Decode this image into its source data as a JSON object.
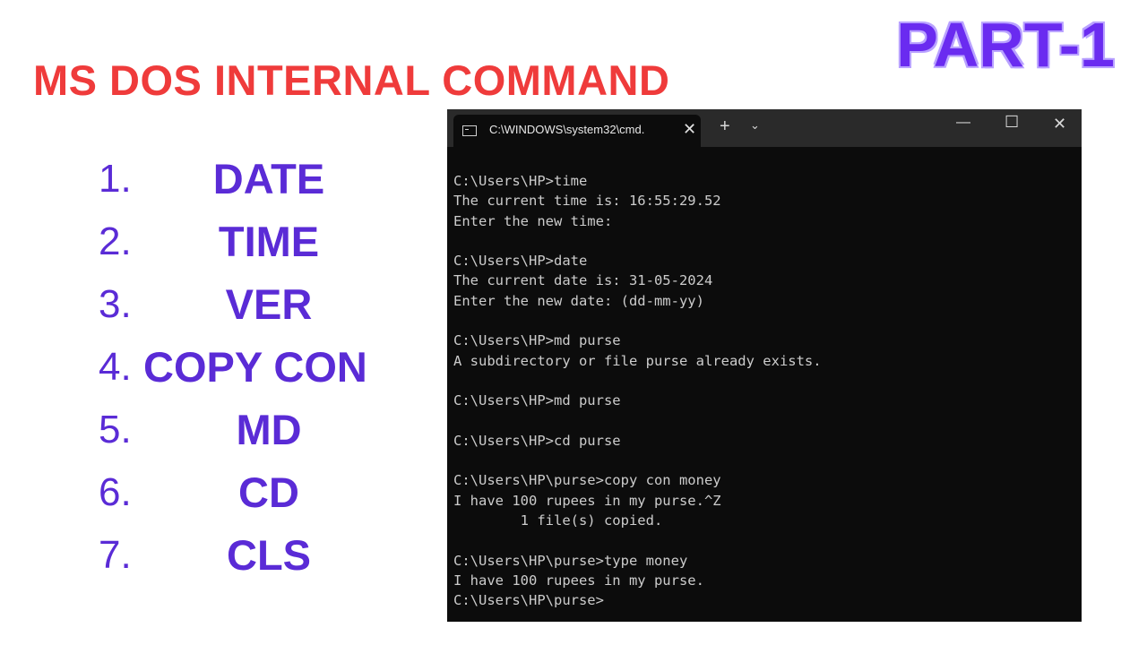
{
  "title": "MS DOS INTERNAL COMMAND",
  "part": "PART-1",
  "commands": [
    {
      "num": "1.",
      "name": "DATE"
    },
    {
      "num": "2.",
      "name": "TIME"
    },
    {
      "num": "3.",
      "name": "VER"
    },
    {
      "num": "4.",
      "name": "COPY CON"
    },
    {
      "num": "5.",
      "name": "MD"
    },
    {
      "num": "6.",
      "name": "CD"
    },
    {
      "num": "7.",
      "name": "CLS"
    }
  ],
  "terminal": {
    "tab_title": "C:\\WINDOWS\\system32\\cmd.",
    "icons": {
      "tab": "cmd-icon",
      "close": "close-icon",
      "new_tab": "plus-icon",
      "dropdown": "chevron-down-icon"
    },
    "window_buttons": {
      "minimize": "—",
      "maximize": "☐",
      "close": "✕"
    },
    "lines": [
      "C:\\Users\\HP>time",
      "The current time is: 16:55:29.52",
      "Enter the new time:",
      "",
      "C:\\Users\\HP>date",
      "The current date is: 31-05-2024",
      "Enter the new date: (dd-mm-yy)",
      "",
      "C:\\Users\\HP>md purse",
      "A subdirectory or file purse already exists.",
      "",
      "C:\\Users\\HP>md purse",
      "",
      "C:\\Users\\HP>cd purse",
      "",
      "C:\\Users\\HP\\purse>copy con money",
      "I have 100 rupees in my purse.^Z",
      "        1 file(s) copied.",
      "",
      "C:\\Users\\HP\\purse>type money",
      "I have 100 rupees in my purse.",
      "C:\\Users\\HP\\purse>"
    ]
  },
  "colors": {
    "title": "#ef3b3b",
    "part": "#6a2bf0",
    "list": "#5a2bd6",
    "terminal_bg": "#0c0c0c"
  }
}
